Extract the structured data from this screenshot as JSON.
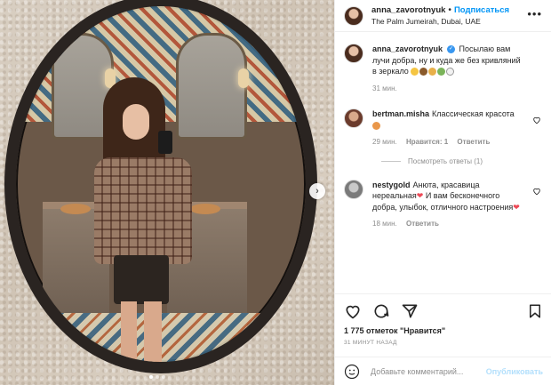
{
  "post": {
    "username": "anna_zavorotnyuk",
    "separator": "•",
    "follow_label": "Подписаться",
    "location": "The Palm Jumeirah, Dubai, UAE",
    "more_icon": "more-horizontal-icon"
  },
  "caption": {
    "username": "anna_zavorotnyuk",
    "text": "Посылаю вам лучи добра, ну и куда же без кривляний в зеркало",
    "time": "31 мин."
  },
  "comments": [
    {
      "username": "bertman.misha",
      "text": "Классическая красота",
      "time": "29 мин.",
      "likes": "Нравится: 1",
      "reply": "Ответить",
      "view_replies": "Посмотреть ответы (1)"
    },
    {
      "username": "nestygold",
      "text_1": "Анюта, красавица нереальная",
      "text_2": " И вам бесконечного добра, улыбок, отличного настроения",
      "time": "18 мин.",
      "reply": "Ответить"
    }
  ],
  "actions": {
    "likes_text": "1 775 отметок \"Нравится\"",
    "time_ago": "31 МИНУТ НАЗАД"
  },
  "add_comment": {
    "placeholder": "Добавьте комментарий...",
    "publish_label": "Опубликовать"
  },
  "carousel": {
    "slides": 3,
    "active": 1
  },
  "colors": {
    "link_blue": "#0095f6",
    "heart_red": "#ed4956",
    "muted": "#8e8e8e",
    "verified": "#3897f0"
  }
}
